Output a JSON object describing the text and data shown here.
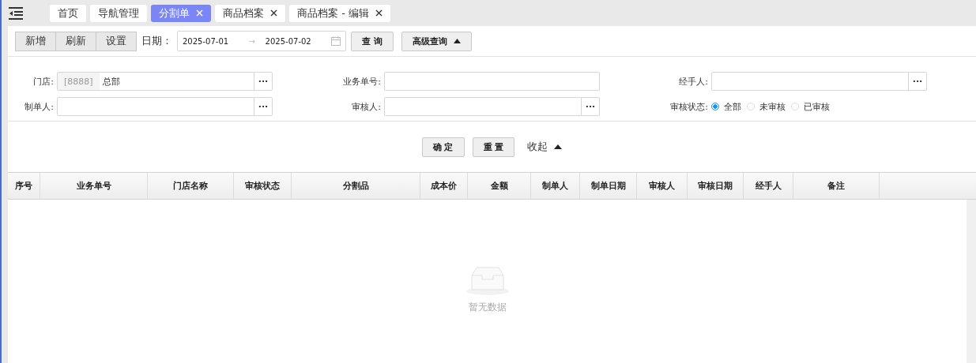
{
  "tabs": [
    {
      "label": "首页",
      "closable": false,
      "selected": false
    },
    {
      "label": "导航管理",
      "closable": false,
      "selected": false
    },
    {
      "label": "分割单",
      "closable": true,
      "selected": true
    },
    {
      "label": "商品档案",
      "closable": true,
      "selected": false
    },
    {
      "label": "商品档案 - 编辑",
      "closable": true,
      "selected": false
    }
  ],
  "toolbar": {
    "buttons": [
      "新增",
      "刷新",
      "设置"
    ],
    "date_label": "日期：",
    "date_from": "2025-07-01",
    "date_arrow": "→",
    "date_to": "2025-07-02",
    "query_button": "查 询",
    "advanced_button": "高级查询",
    "advanced_expanded": true
  },
  "filters": [
    {
      "label": "门店:",
      "kind": "lookup",
      "code": "[8888]",
      "value": "总部",
      "more": "···"
    },
    {
      "label": "业务单号:",
      "kind": "text"
    },
    {
      "label": "经手人:",
      "kind": "lookup",
      "more": "···"
    },
    {
      "label": "制单人:",
      "kind": "lookup",
      "more": "···"
    },
    {
      "label": "审核人:",
      "kind": "lookup",
      "more": "···"
    },
    {
      "label": "审核状态:",
      "kind": "radio",
      "options": [
        {
          "label": "全部",
          "selected": true
        },
        {
          "label": "未审核",
          "selected": false
        },
        {
          "label": "已审核",
          "selected": false
        }
      ]
    }
  ],
  "filter_actions": {
    "confirm": "确 定",
    "reset": "重 置",
    "collapse": "收起"
  },
  "table": {
    "columns": [
      "序号",
      "业务单号",
      "门店名称",
      "审核状态",
      "分割品",
      "成本价",
      "金额",
      "制单人",
      "制单日期",
      "审核人",
      "审核日期",
      "经手人",
      "备注"
    ],
    "empty_text": "暂无数据"
  }
}
